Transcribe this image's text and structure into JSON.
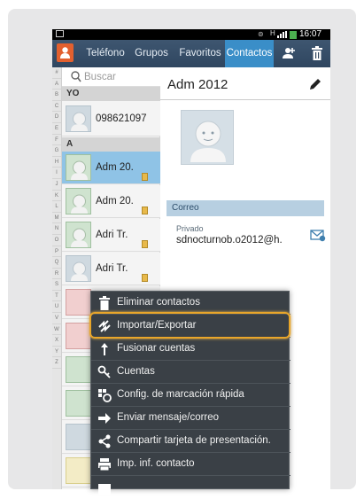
{
  "status_bar": {
    "time": "16:07"
  },
  "tabs": [
    {
      "label": "Teléfono",
      "active": false
    },
    {
      "label": "Grupos",
      "active": false
    },
    {
      "label": "Favoritos",
      "active": false
    },
    {
      "label": "Contactos",
      "active": true
    }
  ],
  "alphabet": [
    "#",
    "A",
    "B",
    "C",
    "D",
    "E",
    "F",
    "G",
    "H",
    "I",
    "J",
    "K",
    "L",
    "M",
    "N",
    "O",
    "P",
    "Q",
    "R",
    "S",
    "T",
    "U",
    "V",
    "W",
    "X",
    "Y",
    "Z"
  ],
  "search": {
    "placeholder": "Buscar"
  },
  "list": {
    "section_yo": "YO",
    "section_a": "A",
    "contacts": [
      {
        "name": "098621097"
      },
      {
        "name": "Adm 20."
      },
      {
        "name": "Adm 20."
      },
      {
        "name": "Adri Tr."
      },
      {
        "name": "Adri Tr."
      }
    ]
  },
  "detail": {
    "title": "Adm 2012",
    "section": "Correo",
    "email_type": "Privado",
    "email_value": "sdnocturnob.o2012@h."
  },
  "menu": {
    "items": [
      {
        "label": "Eliminar contactos",
        "icon": "trash-icon"
      },
      {
        "label": "Importar/Exportar",
        "icon": "import-export-icon",
        "highlighted": true
      },
      {
        "label": "Fusionar cuentas",
        "icon": "merge-icon"
      },
      {
        "label": "Cuentas",
        "icon": "key-icon"
      },
      {
        "label": "Config. de marcación rápida",
        "icon": "speed-dial-icon"
      },
      {
        "label": "Enviar mensaje/correo",
        "icon": "arrow-right-icon"
      },
      {
        "label": "Compartir tarjeta de presentación.",
        "icon": "share-icon"
      },
      {
        "label": "Imp. inf. contacto",
        "icon": "print-icon"
      }
    ]
  },
  "colors": {
    "accent": "#3a8ec8",
    "highlight": "#e9a62a",
    "menu_bg": "#3a4046"
  }
}
